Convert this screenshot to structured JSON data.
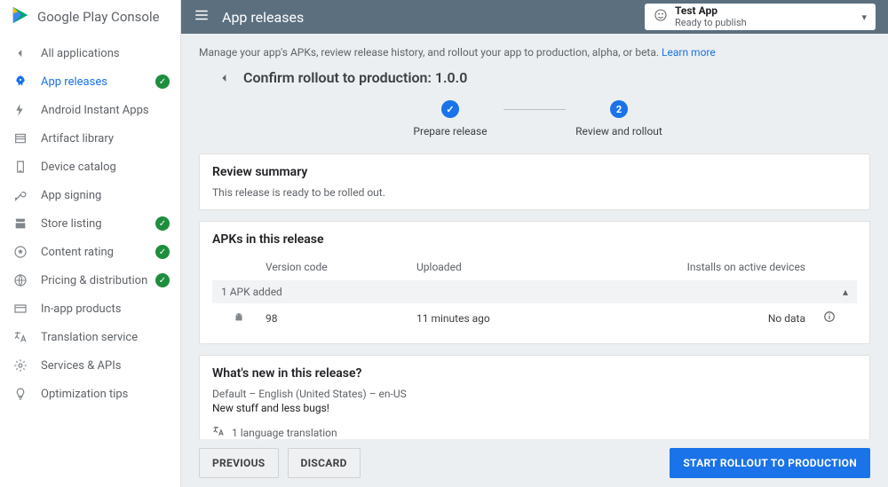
{
  "brand": {
    "name": "Google Play Console"
  },
  "header": {
    "title": "App releases",
    "app_selector": {
      "name": "Test App",
      "status": "Ready to publish"
    }
  },
  "sidebar": {
    "back_label": "All applications",
    "items": [
      {
        "label": "App releases",
        "icon": "rocket-icon",
        "active": true,
        "done": true
      },
      {
        "label": "Android Instant Apps",
        "icon": "bolt-icon",
        "active": false,
        "done": false
      },
      {
        "label": "Artifact library",
        "icon": "library-icon",
        "active": false,
        "done": false
      },
      {
        "label": "Device catalog",
        "icon": "device-icon",
        "active": false,
        "done": false
      },
      {
        "label": "App signing",
        "icon": "key-icon",
        "active": false,
        "done": false
      },
      {
        "label": "Store listing",
        "icon": "store-icon",
        "active": false,
        "done": true
      },
      {
        "label": "Content rating",
        "icon": "rating-icon",
        "active": false,
        "done": true
      },
      {
        "label": "Pricing & distribution",
        "icon": "globe-icon",
        "active": false,
        "done": true
      },
      {
        "label": "In-app products",
        "icon": "card-icon",
        "active": false,
        "done": false
      },
      {
        "label": "Translation service",
        "icon": "translate-icon",
        "active": false,
        "done": false
      },
      {
        "label": "Services & APIs",
        "icon": "gear-icon",
        "active": false,
        "done": false
      },
      {
        "label": "Optimization tips",
        "icon": "bulb-icon",
        "active": false,
        "done": false
      }
    ]
  },
  "intro": {
    "text": "Manage your app's APKs, review release history, and rollout your app to production, alpha, or beta.",
    "link": "Learn more"
  },
  "page_title": "Confirm rollout to production: 1.0.0",
  "stepper": {
    "steps": [
      {
        "label": "Prepare release",
        "display": "✓"
      },
      {
        "label": "Review and rollout",
        "display": "2"
      }
    ]
  },
  "review_summary": {
    "heading": "Review summary",
    "body": "This release is ready to be rolled out."
  },
  "apks": {
    "heading": "APKs in this release",
    "columns": {
      "version": "Version code",
      "uploaded": "Uploaded",
      "installs": "Installs on active devices"
    },
    "band": "1 APK added",
    "rows": [
      {
        "version": "98",
        "uploaded": "11 minutes ago",
        "installs": "No data"
      }
    ]
  },
  "whats_new": {
    "heading": "What's new in this release?",
    "subtitle": "Default – English (United States) – en-US",
    "body": "New stuff and less bugs!",
    "lang_line": "1 language translation"
  },
  "footer": {
    "previous": "Previous",
    "discard": "Discard",
    "start": "Start rollout to production"
  }
}
